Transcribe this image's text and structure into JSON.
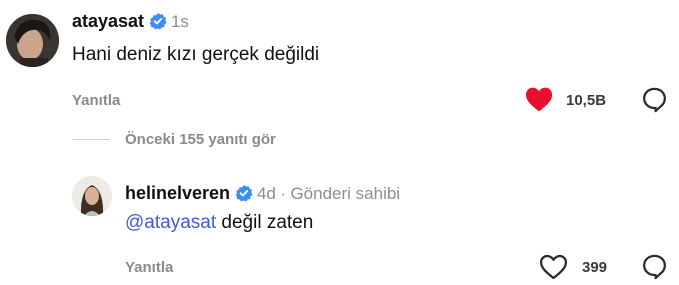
{
  "comment": {
    "username": "atayasat",
    "time": "1s",
    "text": "Hani deniz kızı gerçek değildi",
    "reply_label": "Yanıtla",
    "like_count": "10,5B"
  },
  "thread": {
    "previous_replies_label": "Önceki 155 yanıtı gör"
  },
  "reply": {
    "username": "helinelveren",
    "time": "4d",
    "separator": "·",
    "author_badge": "Gönderi sahibi",
    "mention": "@atayasat",
    "text": " değil zaten",
    "reply_label": "Yanıtla",
    "like_count": "399"
  },
  "colors": {
    "liked_heart": "#e8102e",
    "verified_badge": "#3a8ef6",
    "mention": "#3f5bd8"
  },
  "icons": [
    "verified-badge-icon",
    "heart-filled-icon",
    "heart-outline-icon",
    "share-icon"
  ]
}
